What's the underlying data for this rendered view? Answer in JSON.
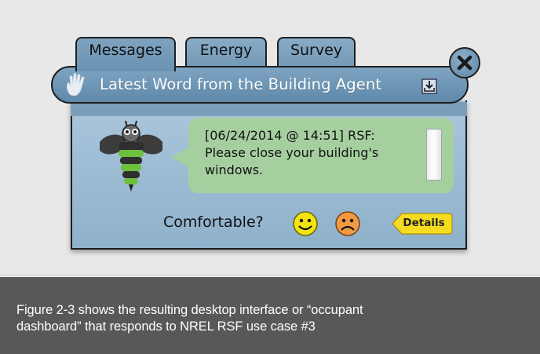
{
  "tabs": [
    {
      "label": "Messages"
    },
    {
      "label": "Energy"
    },
    {
      "label": "Survey"
    }
  ],
  "header": {
    "title": "Latest Word from the Building Agent"
  },
  "message": {
    "line1": "[06/24/2014 @ 14:51] RSF:",
    "line2": "Please close your building's",
    "line3": "windows."
  },
  "feedback": {
    "prompt": "Comfortable?",
    "details_label": "Details"
  },
  "caption": {
    "line1": "Figure 2-3 shows the resulting desktop interface or “occupant",
    "line2": "dashboard” that responds to NREL RSF use case #3"
  },
  "icons": {
    "hand": "hand-icon",
    "download": "download-icon",
    "close": "close-icon",
    "happy": "happy-face-icon",
    "sad": "sad-face-icon",
    "agent": "bee-agent-icon"
  },
  "colors": {
    "header": "#6f95b3",
    "panel": "#9dbcd4",
    "bubble": "#a6cfa0",
    "happy": "#f2e40f",
    "sad": "#f29a43",
    "details": "#f5dc20",
    "caption_bg": "#585858"
  }
}
